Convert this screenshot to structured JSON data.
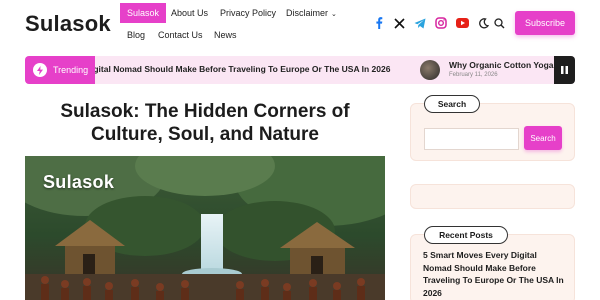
{
  "site": {
    "logo": "Sulasok"
  },
  "nav": {
    "items": [
      {
        "label": "Sulasok",
        "active": true
      },
      {
        "label": "About Us"
      },
      {
        "label": "Privacy Policy"
      },
      {
        "label": "Disclaimer"
      },
      {
        "label": "Blog"
      },
      {
        "label": "Contact Us"
      },
      {
        "label": "News"
      }
    ]
  },
  "social_icons": [
    "facebook-icon",
    "x-twitter-icon",
    "telegram-icon",
    "instagram-icon",
    "youtube-icon",
    "moon-icon",
    "search-icon"
  ],
  "header": {
    "subscribe_label": "Subscribe"
  },
  "ticker": {
    "badge": "Trending",
    "headline1": "igital Nomad Should Make Before Traveling To Europe Or The USA In 2026",
    "headline2": "Why Organic Cotton Yoga Bolster",
    "headline2_date": "February 11, 2026"
  },
  "article": {
    "title": "Sulasok: The Hidden Corners of Culture, Soul, and Nature",
    "hero_brand": "Sulasok"
  },
  "sidebar": {
    "search": {
      "heading": "Search",
      "button": "Search",
      "placeholder": ""
    },
    "recent": {
      "heading": "Recent Posts",
      "posts": [
        "5 Smart Moves Every Digital Nomad Should Make Before Traveling To Europe Or The USA In 2026"
      ]
    }
  },
  "colors": {
    "accent": "#e640c9",
    "ticker_bg": "#fbe6f4",
    "widget_bg": "#fdf3ee"
  }
}
